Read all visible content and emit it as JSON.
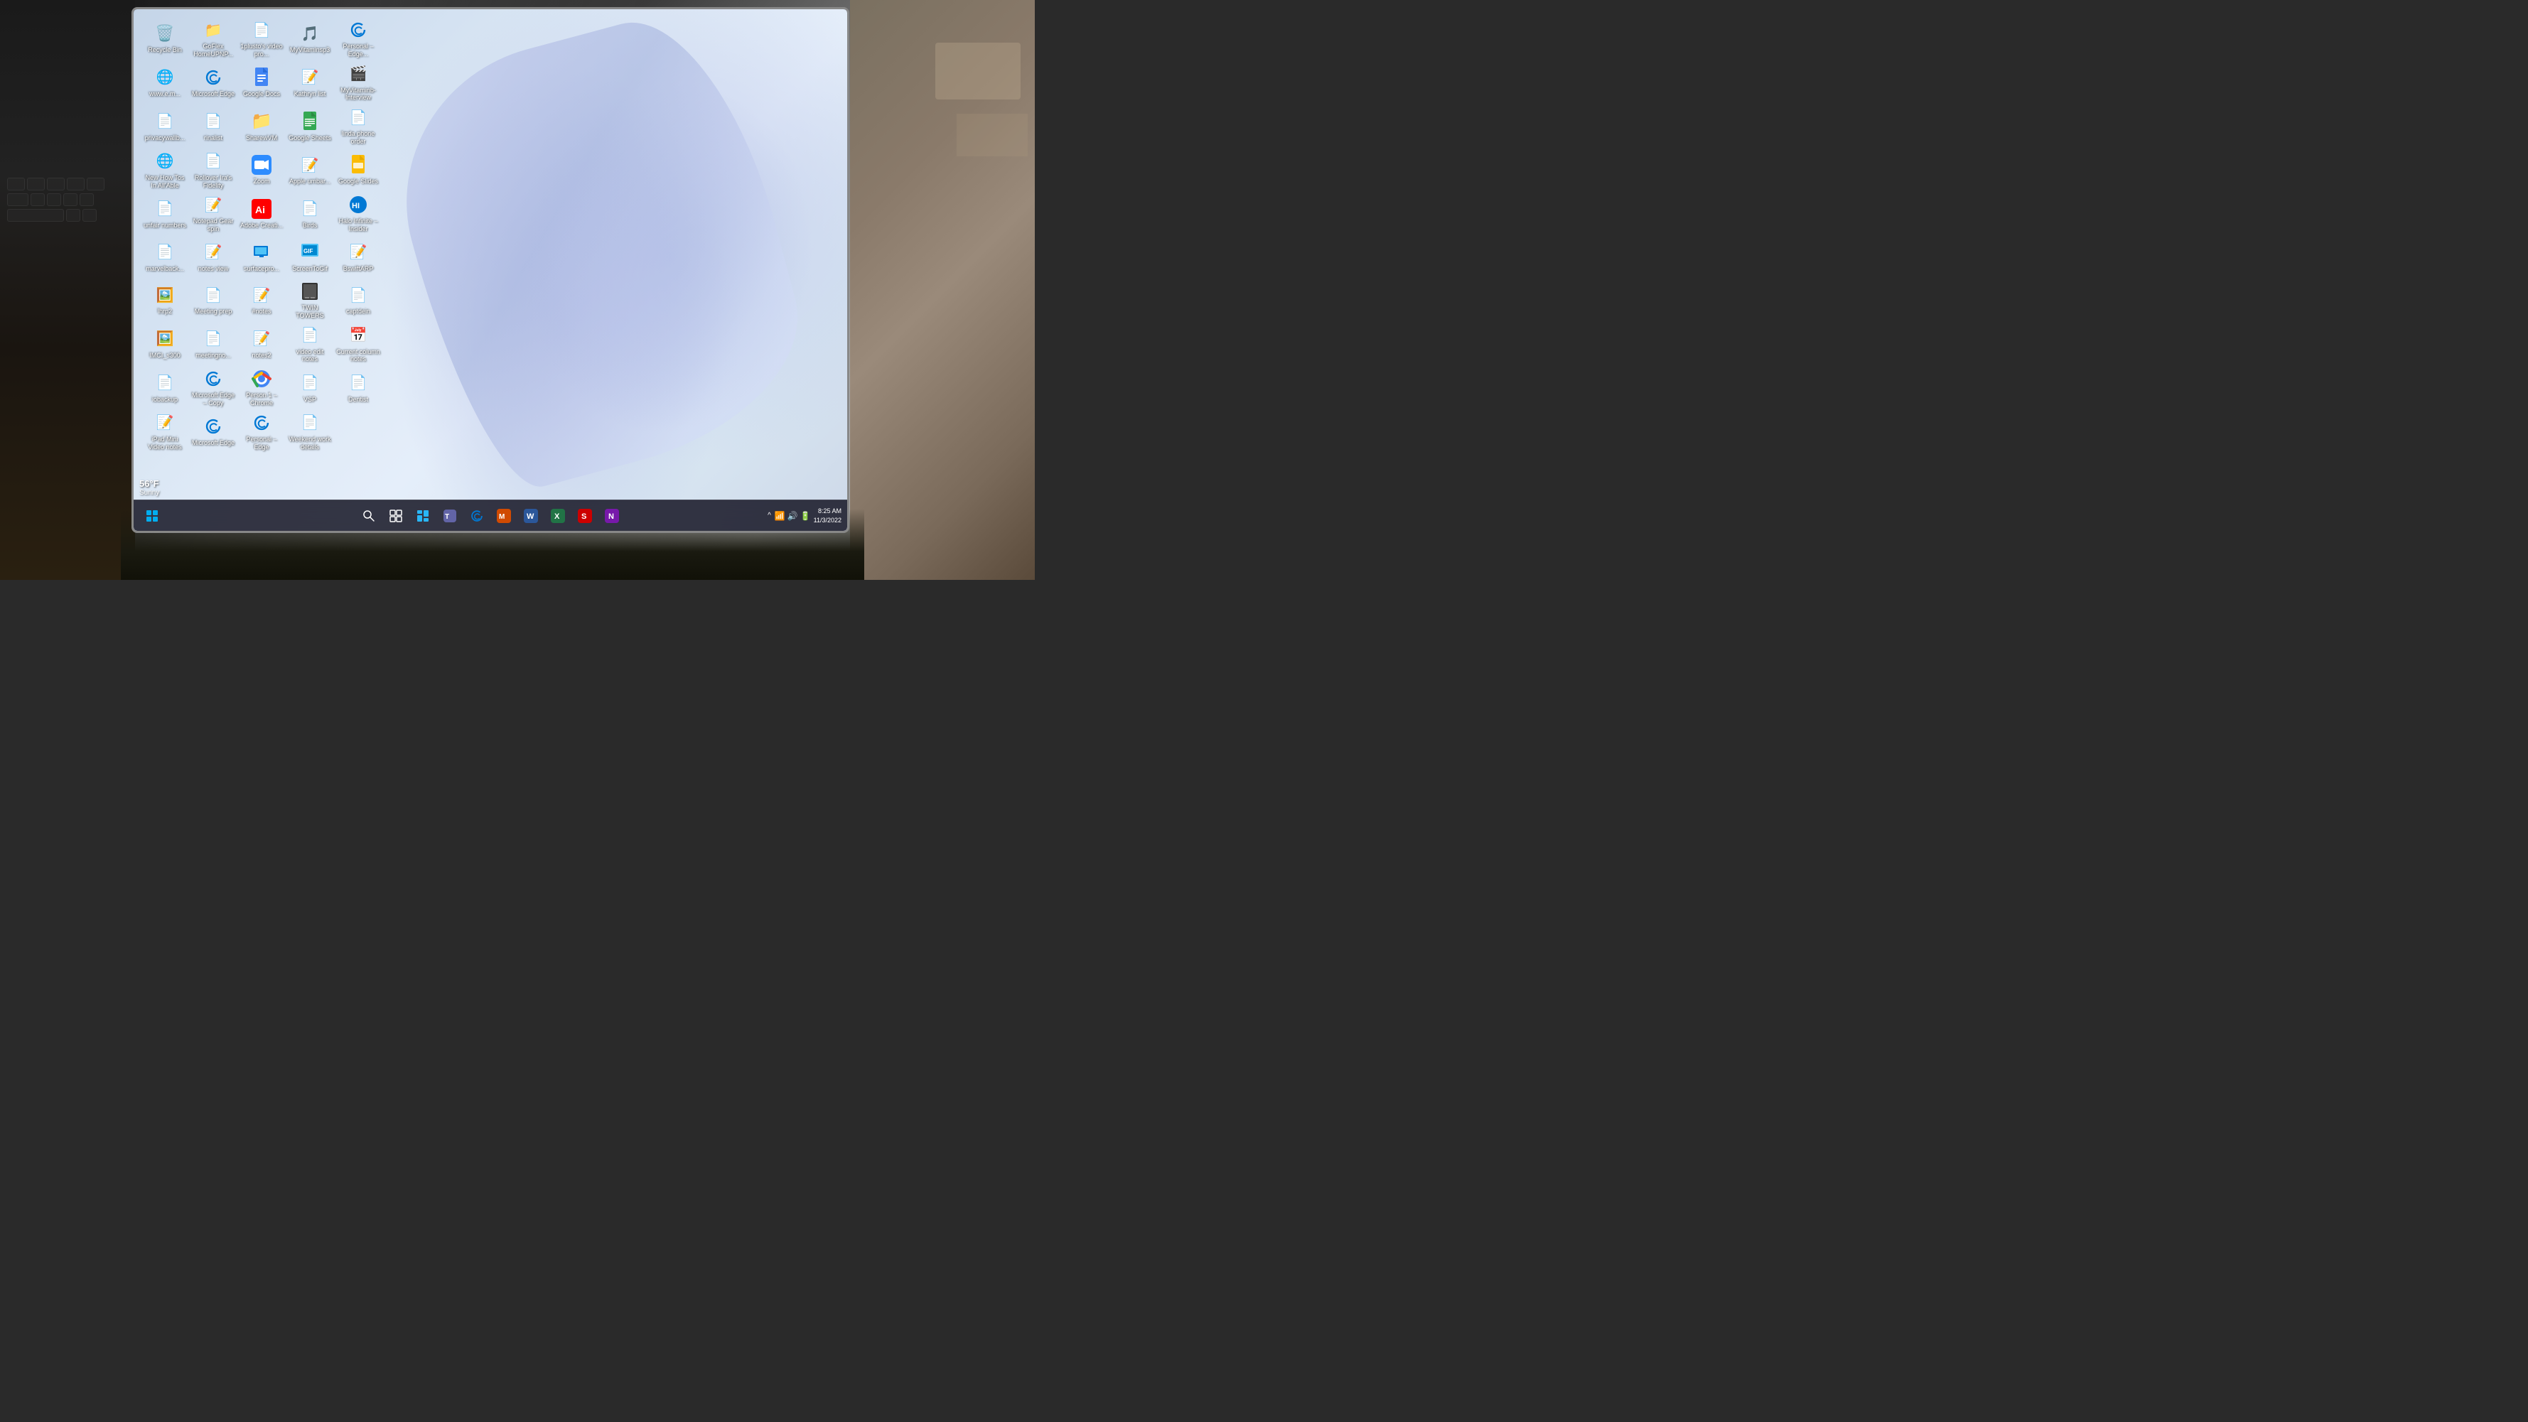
{
  "desktop": {
    "wallpaper": "Windows 11 default bloom wallpaper",
    "icons": [
      {
        "id": "recycle-bin",
        "label": "Recycle Bin",
        "type": "system",
        "col": 1,
        "row": 1
      },
      {
        "id": "goflex",
        "label": "GoFlex HomeUPNP...",
        "type": "file",
        "col": 2,
        "row": 1
      },
      {
        "id": "video-pro",
        "label": "1plusto's video pro...",
        "type": "file",
        "col": 3,
        "row": 1
      },
      {
        "id": "myvitaminsp3",
        "label": "MyVitaminsp3",
        "type": "file",
        "col": 4,
        "row": 1
      },
      {
        "id": "personal-edge-fav",
        "label": "Personal – Edge...",
        "type": "edge",
        "col": 5,
        "row": 1
      },
      {
        "id": "www-shortcut",
        "label": "www.e.m...",
        "type": "web",
        "col": 6,
        "row": 1
      },
      {
        "id": "microsoft-edge",
        "label": "Microsoft Edge",
        "type": "edge",
        "col": 1,
        "row": 2
      },
      {
        "id": "google-docs",
        "label": "Google Docs",
        "type": "gdocs",
        "col": 2,
        "row": 2
      },
      {
        "id": "kathryn-list",
        "label": "Kathryn list",
        "type": "doc",
        "col": 3,
        "row": 2
      },
      {
        "id": "myvitaminb-interview",
        "label": "MyVitaminb-Interview",
        "type": "file",
        "col": 4,
        "row": 2
      },
      {
        "id": "privacywallb",
        "label": "privacywallb...",
        "type": "file",
        "col": 5,
        "row": 2
      },
      {
        "id": "rinalist",
        "label": "rinalist",
        "type": "doc",
        "col": 6,
        "row": 2
      },
      {
        "id": "sharewvm",
        "label": "SharewVM",
        "type": "folder",
        "col": 1,
        "row": 3
      },
      {
        "id": "google-sheets",
        "label": "Google Sheets",
        "type": "gsheets",
        "col": 2,
        "row": 3
      },
      {
        "id": "linda-phone-order",
        "label": "linda phone order",
        "type": "doc",
        "col": 3,
        "row": 3
      },
      {
        "id": "new-how-tos",
        "label": "New How Tos In All'Able",
        "type": "web",
        "col": 4,
        "row": 3
      },
      {
        "id": "rollover-fidelity",
        "label": "Rollover Ira's Fidelity",
        "type": "file",
        "col": 5,
        "row": 3
      },
      {
        "id": "zoom",
        "label": "Zoom",
        "type": "zoom",
        "col": 6,
        "row": 3
      },
      {
        "id": "apple-umbar",
        "label": "Apple umbar...",
        "type": "doc",
        "col": 1,
        "row": 4
      },
      {
        "id": "google-slides",
        "label": "Google Slides",
        "type": "gslides",
        "col": 2,
        "row": 4
      },
      {
        "id": "unfair-numbers",
        "label": "unfair numbers",
        "type": "doc",
        "col": 3,
        "row": 4
      },
      {
        "id": "notepad-gear-spin",
        "label": "Notepad Gear spin",
        "type": "notepad",
        "col": 4,
        "row": 4
      },
      {
        "id": "adobe-creative",
        "label": "Adobe Creati...",
        "type": "adobe",
        "col": 5,
        "row": 4
      },
      {
        "id": "birds",
        "label": "Birds",
        "type": "doc",
        "col": 1,
        "row": 5
      },
      {
        "id": "halo-infinite",
        "label": "Halo Infinite – Insider",
        "type": "game",
        "col": 2,
        "row": 5
      },
      {
        "id": "marvelback",
        "label": "marvelback...",
        "type": "doc",
        "col": 3,
        "row": 5
      },
      {
        "id": "notes-view",
        "label": "notes view",
        "type": "doc",
        "col": 4,
        "row": 5
      },
      {
        "id": "surfacepro",
        "label": "surfacepro...",
        "type": "file",
        "col": 5,
        "row": 5
      },
      {
        "id": "screentogif",
        "label": "ScreenToGif",
        "type": "app",
        "col": 6,
        "row": 5
      },
      {
        "id": "bswiftarp",
        "label": "BswiftARP",
        "type": "doc",
        "col": 1,
        "row": 6
      },
      {
        "id": "lhrp2",
        "label": "lhrp2",
        "type": "photo",
        "col": 2,
        "row": 6
      },
      {
        "id": "meeting-prep",
        "label": "Meeting prep",
        "type": "doc",
        "col": 3,
        "row": 6
      },
      {
        "id": "notes",
        "label": "#notes",
        "type": "doc",
        "col": 4,
        "row": 6
      },
      {
        "id": "twin-towers",
        "label": "TWIN TOWERS",
        "type": "file",
        "col": 5,
        "row": 6
      },
      {
        "id": "captdein",
        "label": "captdein",
        "type": "doc",
        "col": 1,
        "row": 7
      },
      {
        "id": "imci-s300",
        "label": "IMCI_s300",
        "type": "photo",
        "col": 2,
        "row": 7
      },
      {
        "id": "meetingno",
        "label": "meetingno...",
        "type": "doc",
        "col": 3,
        "row": 7
      },
      {
        "id": "notes2",
        "label": "notes2",
        "type": "doc",
        "col": 4,
        "row": 7
      },
      {
        "id": "video-edit-notes",
        "label": "video edit notes",
        "type": "doc",
        "col": 5,
        "row": 7
      },
      {
        "id": "current-column-notes",
        "label": "Current column notes",
        "type": "doc",
        "col": 1,
        "row": 8
      },
      {
        "id": "iobackup",
        "label": "iobackup",
        "type": "doc",
        "col": 2,
        "row": 8
      },
      {
        "id": "microsoft-edge-copy",
        "label": "Microsoft Edge – Copy",
        "type": "edge",
        "col": 3,
        "row": 8
      },
      {
        "id": "person-chrome",
        "label": "Person 1 – Chrome",
        "type": "chrome",
        "col": 4,
        "row": 8
      },
      {
        "id": "vsp",
        "label": "VSP",
        "type": "doc",
        "col": 5,
        "row": 8
      },
      {
        "id": "dentist",
        "label": "Dentist",
        "type": "doc",
        "col": 1,
        "row": 9
      },
      {
        "id": "ipad-mini-video",
        "label": "iPad Mini Video notes",
        "type": "doc",
        "col": 2,
        "row": 9
      },
      {
        "id": "microsoft-edge-9",
        "label": "Microsoft Edge",
        "type": "edge",
        "col": 3,
        "row": 9
      },
      {
        "id": "personal-edge",
        "label": "Personal – Edge",
        "type": "edge",
        "col": 4,
        "row": 9
      },
      {
        "id": "weekend-work",
        "label": "Weekend work details",
        "type": "doc",
        "col": 5,
        "row": 9
      }
    ]
  },
  "taskbar": {
    "start_label": "⊞",
    "search_label": "🔍",
    "taskview_label": "⧉",
    "widgets_label": "📰",
    "teams_label": "💬",
    "edge_label": "🌐",
    "office_label": "🏢",
    "word_label": "W",
    "excel_label": "X",
    "scratch_label": "S",
    "onenote_label": "N",
    "time": "8:25 AM",
    "date": "11/3/2022",
    "weather_temp": "56°F",
    "weather_condition": "Sunny"
  },
  "system_tray": {
    "icons": [
      "^",
      "wifi",
      "volume",
      "battery"
    ]
  }
}
